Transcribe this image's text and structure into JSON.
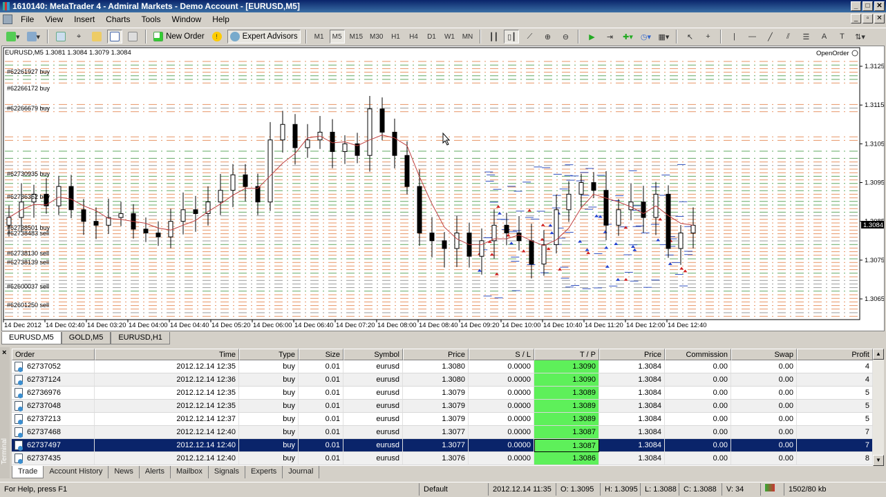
{
  "window": {
    "title": "1610140: MetaTrader 4 - Admiral Markets - Demo Account - [EURUSD,M5]"
  },
  "menu": [
    "File",
    "View",
    "Insert",
    "Charts",
    "Tools",
    "Window",
    "Help"
  ],
  "toolbar": {
    "new_order": "New Order",
    "expert_advisors": "Expert Advisors",
    "timeframes": [
      "M1",
      "M5",
      "M15",
      "M30",
      "H1",
      "H4",
      "D1",
      "W1",
      "MN"
    ],
    "active_timeframe": "M5"
  },
  "chart": {
    "info": "EURUSD,M5  1.3081 1.3084 1.3079 1.3084",
    "indicator_label": "OpenOrder",
    "current_price": "1.3084",
    "price_ticks": [
      "1.3125",
      "1.3115",
      "1.3105",
      "1.3095",
      "1.3085",
      "1.3075",
      "1.3065"
    ],
    "time_ticks": [
      "14 Dec 2012",
      "14 Dec 02:40",
      "14 Dec 03:20",
      "14 Dec 04:00",
      "14 Dec 04:40",
      "14 Dec 05:20",
      "14 Dec 06:00",
      "14 Dec 06:40",
      "14 Dec 07:20",
      "14 Dec 08:00",
      "14 Dec 08:40",
      "14 Dec 09:20",
      "14 Dec 10:00",
      "14 Dec 10:40",
      "14 Dec 11:20",
      "14 Dec 12:00",
      "14 Dec 12:40"
    ],
    "order_labels": [
      "#62261927 buy",
      "#62266172 buy",
      "#62266679 buy",
      "#62730935 buy",
      "#62736362 buy",
      "#62738501 buy",
      "#62738483 sell",
      "#62738130 sell",
      "#62738139 sell",
      "#62600037 sell",
      "#62601250 sell"
    ],
    "colors": {
      "ma": "#c04040",
      "buy_line": "#2e8b2e",
      "sell_line": "#e07030",
      "bull": "#ffffff",
      "bear": "#000000"
    }
  },
  "chart_data": {
    "type": "candlestick",
    "closes": [
      1.3086,
      1.309,
      1.3092,
      1.3089,
      1.3094,
      1.3088,
      1.3085,
      1.3084,
      1.3086,
      1.3087,
      1.3083,
      1.3082,
      1.3081,
      1.3085,
      1.3088,
      1.3087,
      1.309,
      1.3093,
      1.3097,
      1.3094,
      1.309,
      1.3106,
      1.311,
      1.3104,
      1.3106,
      1.3108,
      1.3103,
      1.3105,
      1.3102,
      1.3114,
      1.3108,
      1.3102,
      1.3094,
      1.3082,
      1.308,
      1.3078,
      1.3082,
      1.3076,
      1.308,
      1.3084,
      1.3082,
      1.308,
      1.3074,
      1.3079,
      1.3088,
      1.3092,
      1.3095,
      1.3093,
      1.3084,
      1.3088,
      1.309,
      1.3086,
      1.3092,
      1.3078,
      1.3082,
      1.3084
    ],
    "ylim": [
      1.306,
      1.313
    ]
  },
  "chart_tabs": [
    "EURUSD,M5",
    "GOLD,M5",
    "EURUSD,H1"
  ],
  "terminal": {
    "side_label": "Terminal",
    "columns": [
      "Order",
      "Time",
      "Type",
      "Size",
      "Symbol",
      "Price",
      "S / L",
      "T / P",
      "Price",
      "Commission",
      "Swap",
      "Profit"
    ],
    "rows": [
      [
        "62737052",
        "2012.12.14 12:35",
        "buy",
        "0.01",
        "eurusd",
        "1.3080",
        "0.0000",
        "1.3090",
        "1.3084",
        "0.00",
        "0.00",
        "4"
      ],
      [
        "62737124",
        "2012.12.14 12:36",
        "buy",
        "0.01",
        "eurusd",
        "1.3080",
        "0.0000",
        "1.3090",
        "1.3084",
        "0.00",
        "0.00",
        "4"
      ],
      [
        "62736976",
        "2012.12.14 12:35",
        "buy",
        "0.01",
        "eurusd",
        "1.3079",
        "0.0000",
        "1.3089",
        "1.3084",
        "0.00",
        "0.00",
        "5"
      ],
      [
        "62737048",
        "2012.12.14 12:35",
        "buy",
        "0.01",
        "eurusd",
        "1.3079",
        "0.0000",
        "1.3089",
        "1.3084",
        "0.00",
        "0.00",
        "5"
      ],
      [
        "62737213",
        "2012.12.14 12:37",
        "buy",
        "0.01",
        "eurusd",
        "1.3079",
        "0.0000",
        "1.3089",
        "1.3084",
        "0.00",
        "0.00",
        "5"
      ],
      [
        "62737468",
        "2012.12.14 12:40",
        "buy",
        "0.01",
        "eurusd",
        "1.3077",
        "0.0000",
        "1.3087",
        "1.3084",
        "0.00",
        "0.00",
        "7"
      ],
      [
        "62737497",
        "2012.12.14 12:40",
        "buy",
        "0.01",
        "eurusd",
        "1.3077",
        "0.0000",
        "1.3087",
        "1.3084",
        "0.00",
        "0.00",
        "7"
      ],
      [
        "62737435",
        "2012.12.14 12:40",
        "buy",
        "0.01",
        "eurusd",
        "1.3076",
        "0.0000",
        "1.3086",
        "1.3084",
        "0.00",
        "0.00",
        "8"
      ]
    ],
    "selected_row": 6,
    "tabs": [
      "Trade",
      "Account History",
      "News",
      "Alerts",
      "Mailbox",
      "Signals",
      "Experts",
      "Journal"
    ],
    "active_tab": "Trade"
  },
  "status": {
    "help": "For Help, press F1",
    "profile": "Default",
    "time": "2012.12.14 11:35",
    "open": "O: 1.3095",
    "high": "H: 1.3095",
    "low": "L: 1.3088",
    "close": "C: 1.3088",
    "volume": "V: 34",
    "traffic": "1502/80 kb"
  }
}
